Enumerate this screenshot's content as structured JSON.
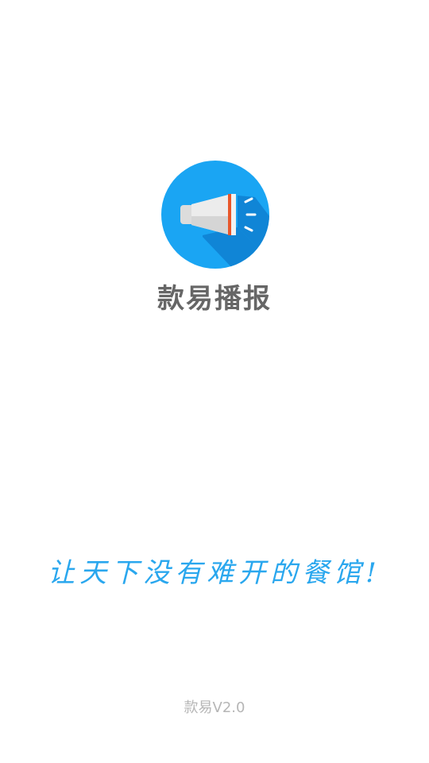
{
  "splash": {
    "app_name": "款易播报",
    "slogan": "让天下没有难开的餐馆!",
    "version": "款易V2.0"
  },
  "logo": {
    "icon": "megaphone-icon",
    "background_color": "#1aa5f3",
    "shadow_color": "#0f7fd0",
    "horn_color": "#e9e9e9",
    "stripe_color": "#e8562a",
    "sound_wave_color": "#ffffff"
  },
  "colors": {
    "app_name": "#666666",
    "slogan": "#2aa7ee",
    "version": "#b6b6b6"
  }
}
